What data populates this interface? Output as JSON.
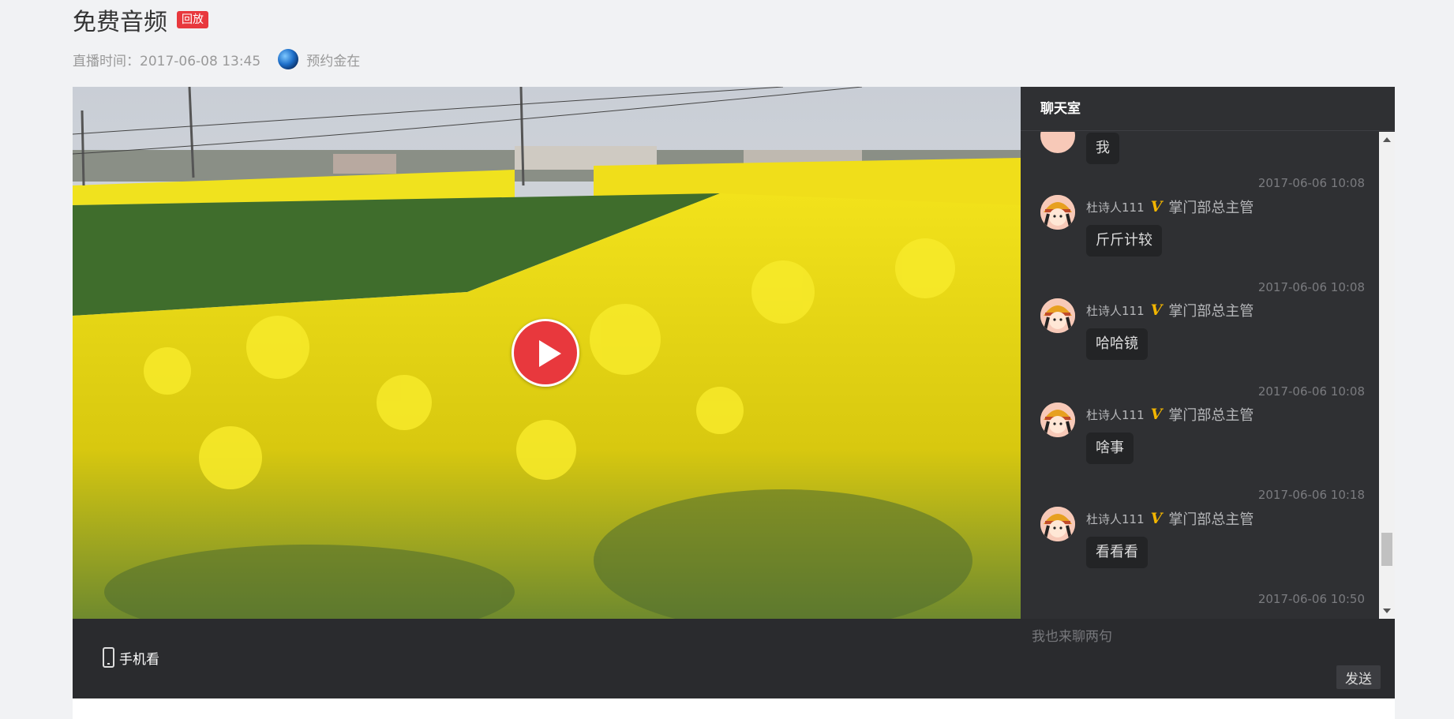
{
  "header": {
    "title": "免费音频",
    "badge": "回放",
    "time_label": "直播时间：2017-06-08 13:45",
    "org_name": "预约金在"
  },
  "chat": {
    "title": "聊天室",
    "messages": [
      {
        "time": "",
        "user": "",
        "role": "",
        "text": "我"
      },
      {
        "time": "2017-06-06 10:08",
        "user": "杜诗人111",
        "vip": "V",
        "role": "掌门部总主管",
        "text": "斤斤计较"
      },
      {
        "time": "2017-06-06 10:08",
        "user": "杜诗人111",
        "vip": "V",
        "role": "掌门部总主管",
        "text": "哈哈镜"
      },
      {
        "time": "2017-06-06 10:08",
        "user": "杜诗人111",
        "vip": "V",
        "role": "掌门部总主管",
        "text": "啥事"
      },
      {
        "time": "2017-06-06 10:18",
        "user": "杜诗人111",
        "vip": "V",
        "role": "掌门部总主管",
        "text": "看看看"
      },
      {
        "time": "2017-06-06 10:50",
        "user": "",
        "role": "",
        "text": ""
      }
    ],
    "input_placeholder": "我也来聊两句",
    "send_label": "发送"
  },
  "bottom": {
    "mobile_label": "手机看"
  },
  "colors": {
    "accent": "#e8383d",
    "chat_bg": "#2f3033",
    "bar_bg": "#2a2b2e",
    "vip": "#f2b500",
    "page_bg": "#f1f2f4"
  }
}
